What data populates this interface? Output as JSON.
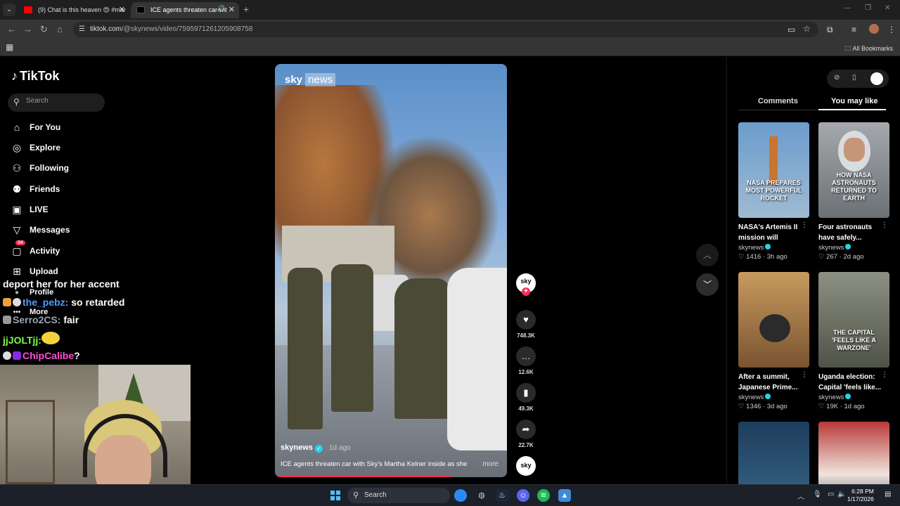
{
  "browser": {
    "tabs": [
      {
        "title": "(9) Chat is this heaven 😍 #mar",
        "active": false
      },
      {
        "title": "ICE agents threaten car wit",
        "active": true
      }
    ],
    "url_host": "tiktok.com",
    "url_path": "/@skynews/video/7595971261205908758",
    "bookmarks_label": "All Bookmarks"
  },
  "sidebar": {
    "logo": "TikTok",
    "search_placeholder": "Search",
    "items": [
      {
        "label": "For You",
        "icon": "home-icon"
      },
      {
        "label": "Explore",
        "icon": "compass-icon"
      },
      {
        "label": "Following",
        "icon": "following-icon"
      },
      {
        "label": "Friends",
        "icon": "friends-icon"
      },
      {
        "label": "LIVE",
        "icon": "live-icon"
      },
      {
        "label": "Messages",
        "icon": "messages-icon"
      },
      {
        "label": "Activity",
        "icon": "activity-icon",
        "badge": "94"
      },
      {
        "label": "Upload",
        "icon": "upload-icon"
      }
    ],
    "profile_label": "Profile",
    "more_label": "More"
  },
  "chat": [
    {
      "user": "",
      "message": "deport her for her accent",
      "user_color": "#ffffff"
    },
    {
      "user": "the_pebz:",
      "message": " so retarded",
      "user_color": "#4f9cff"
    },
    {
      "user": "Serro2CS:",
      "message": " fair",
      "user_color": "#9aa4b4"
    },
    {
      "user": "jjJOLTjj:",
      "message": "",
      "user_color": "#7cff4f"
    },
    {
      "user": "ChipCalibe",
      "message": "?",
      "user_color": "#ff4fd8"
    }
  ],
  "video": {
    "overlay_brand": "sky",
    "overlay_brand2": "news",
    "author": "skynews",
    "posted": "1d ago",
    "caption": "ICE agents threaten car with Sky's Martha Kelner inside as she",
    "more_label": "more",
    "progress": 0.76
  },
  "actions": {
    "likes": "748.3K",
    "comments": "12.6K",
    "saves": "49.3K",
    "shares": "22.7K",
    "avatar_text": "sky"
  },
  "right_panel": {
    "tabs": [
      "Comments",
      "You may like"
    ],
    "active_tab": "You may like",
    "cards": [
      {
        "thumb_text": "NASA PREPARES MOST POWERFUL ROCKET",
        "title": "NASA's Artemis II mission will mark...",
        "author": "skynews",
        "likes": "1416",
        "ago": "3h ago",
        "bg": "#7aa6d4"
      },
      {
        "thumb_text": "HOW NASA ASTRONAUTS RETURNED TO EARTH",
        "title": "Four astronauts have safely...",
        "author": "skynews",
        "likes": "267",
        "ago": "2d ago",
        "bg": "#8a8f93"
      },
      {
        "thumb_text": "",
        "title": "After a summit, Japanese Prime...",
        "author": "skynews",
        "likes": "1346",
        "ago": "3d ago",
        "bg": "#a88052"
      },
      {
        "thumb_text": "THE CAPITAL 'FEELS LIKE A WARZONE'",
        "title": "Uganda election: Capital 'feels like...",
        "author": "skynews",
        "likes": "19K",
        "ago": "1d ago",
        "bg": "#6f7364"
      },
      {
        "thumb_text": "",
        "title": "",
        "author": "",
        "likes": "",
        "ago": "",
        "bg": "#1e3d5c"
      },
      {
        "thumb_text": "",
        "title": "",
        "author": "",
        "likes": "",
        "ago": "",
        "bg": "#b83a3a"
      }
    ]
  },
  "taskbar": {
    "search_label": "Search",
    "time": "6:28 PM",
    "date": "1/17/2026"
  }
}
